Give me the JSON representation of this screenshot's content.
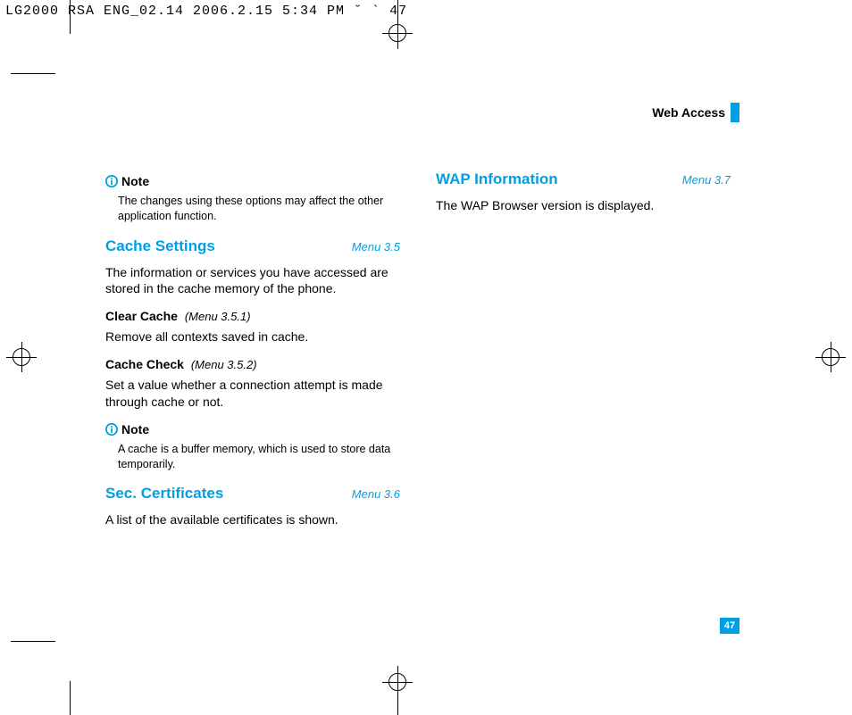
{
  "meta_header": "LG2000 RSA ENG_02.14  2006.2.15 5:34 PM  ˘    ` 47",
  "header": {
    "title": "Web Access"
  },
  "left": {
    "note1": {
      "label": "Note",
      "body": "The changes using these options may affect the other application function."
    },
    "sec1": {
      "title": "Cache Settings",
      "menu": "Menu 3.5",
      "body": "The information or services you have accessed are stored in the cache memory of the phone.",
      "sub1": {
        "title": "Clear Cache",
        "menu": "(Menu 3.5.1)",
        "body": "Remove all contexts saved in cache."
      },
      "sub2": {
        "title": "Cache Check",
        "menu": "(Menu 3.5.2)",
        "body": "Set a value whether a connection attempt is made through cache or not."
      }
    },
    "note2": {
      "label": "Note",
      "body": "A cache is a buffer memory, which is used to store data temporarily."
    },
    "sec2": {
      "title": "Sec. Certificates",
      "menu": "Menu 3.6",
      "body": "A list of the available certificates is shown."
    }
  },
  "right": {
    "sec1": {
      "title": "WAP Information",
      "menu": "Menu 3.7",
      "body": "The WAP Browser version is displayed."
    }
  },
  "page_number": "47"
}
